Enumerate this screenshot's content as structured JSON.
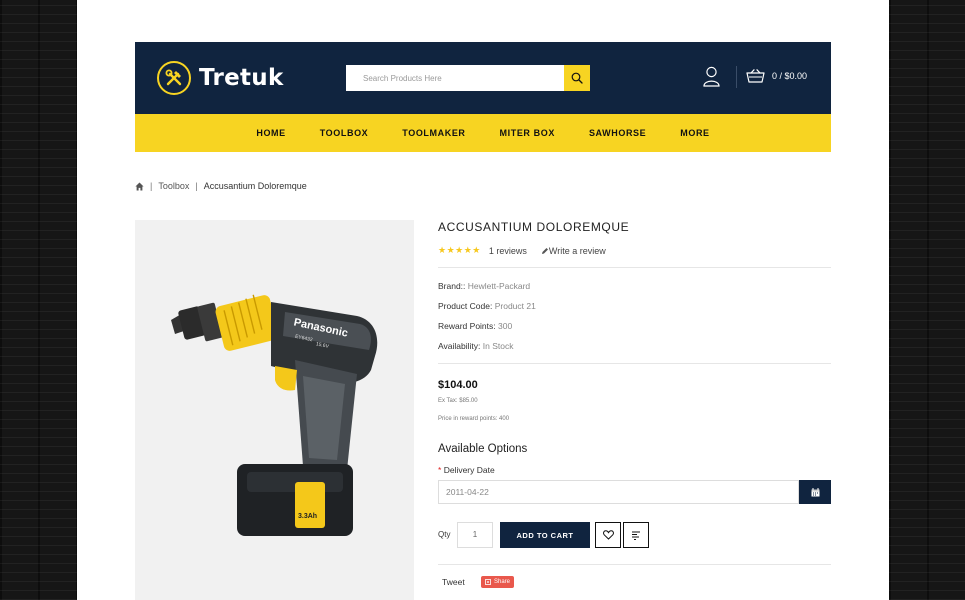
{
  "header": {
    "logo_text": "Tretuk",
    "search_placeholder": "Search Products Here",
    "cart_text": "0 / $0.00"
  },
  "menu": {
    "items": [
      "HOME",
      "TOOLBOX",
      "TOOLMAKER",
      "MITER BOX",
      "SAWHORSE",
      "MORE"
    ]
  },
  "breadcrumb": {
    "home_icon": "home-icon",
    "separator": "|",
    "items": [
      "Toolbox",
      "Accusantium Doloremque"
    ]
  },
  "product": {
    "title": "ACCUSANTIUM DOLOREMQUE",
    "rating_stars": "★★★★★",
    "rating": 5,
    "reviews": "1 reviews",
    "write_review": "Write a review",
    "brand_label": "Brand::",
    "brand_value": "Hewlett-Packard",
    "code_label": "Product Code:",
    "code_value": "Product 21",
    "points_label": "Reward Points:",
    "points_value": "300",
    "avail_label": "Availability:",
    "avail_value": "In Stock",
    "price": "$104.00",
    "ex_tax": "Ex Tax: $85.00",
    "reward_price": "Price in reward points: 400",
    "image_brand": "Panasonic",
    "image_model": "EY6432",
    "image_voltage": "15.6V",
    "image_battery": "3.3Ah"
  },
  "options": {
    "title": "Available Options",
    "required_mark": "*",
    "delivery_label": "Delivery Date",
    "delivery_value": "2011-04-22"
  },
  "cart": {
    "qty_label": "Qty",
    "qty_value": "1",
    "add_label": "ADD TO CART"
  },
  "social": {
    "tweet": "Tweet",
    "share": "Share"
  },
  "colors": {
    "navy": "#10243f",
    "yellow": "#f7d422"
  }
}
